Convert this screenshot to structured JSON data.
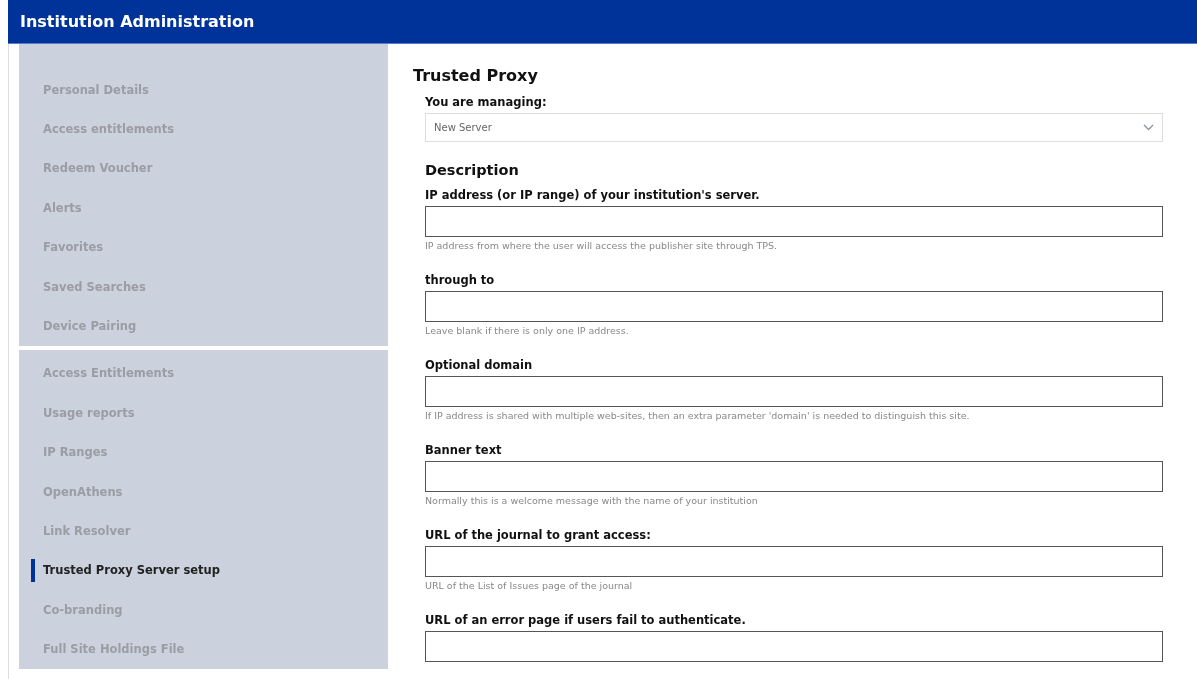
{
  "header": {
    "title": "Institution Administration"
  },
  "sidebar": {
    "groups": [
      {
        "items": [
          {
            "label": "Personal Details",
            "selected": false
          },
          {
            "label": "Access entitlements",
            "selected": false
          },
          {
            "label": "Redeem Voucher",
            "selected": false
          },
          {
            "label": "Alerts",
            "selected": false
          },
          {
            "label": "Favorites",
            "selected": false
          },
          {
            "label": "Saved Searches",
            "selected": false
          },
          {
            "label": "Device Pairing",
            "selected": false
          }
        ]
      },
      {
        "items": [
          {
            "label": "Access Entitlements",
            "selected": false
          },
          {
            "label": "Usage reports",
            "selected": false
          },
          {
            "label": "IP Ranges",
            "selected": false
          },
          {
            "label": "OpenAthens",
            "selected": false
          },
          {
            "label": "Link Resolver",
            "selected": false
          },
          {
            "label": "Trusted Proxy Server setup",
            "selected": true
          },
          {
            "label": "Co-branding",
            "selected": false
          },
          {
            "label": "Full Site Holdings File",
            "selected": false
          }
        ]
      }
    ]
  },
  "main": {
    "title": "Trusted Proxy",
    "managing": {
      "label": "You are managing:",
      "value": "New Server"
    },
    "section_title": "Description",
    "fields": [
      {
        "label": "IP address (or IP range) of your institution's server.",
        "hint": "IP address from where the user will access the publisher site through TPS."
      },
      {
        "label": "through to",
        "hint": "Leave blank if there is only one IP address."
      },
      {
        "label": "Optional domain",
        "hint": "If IP address is shared with multiple web-sites, then an extra parameter 'domain' is needed to distinguish this site."
      },
      {
        "label": "Banner text",
        "hint": "Normally this is a welcome message with the name of your institution"
      },
      {
        "label": "URL of the journal to grant access:",
        "hint": "URL of the List of Issues page of the journal"
      },
      {
        "label": "URL of an error page if users fail to authenticate."
      }
    ]
  }
}
